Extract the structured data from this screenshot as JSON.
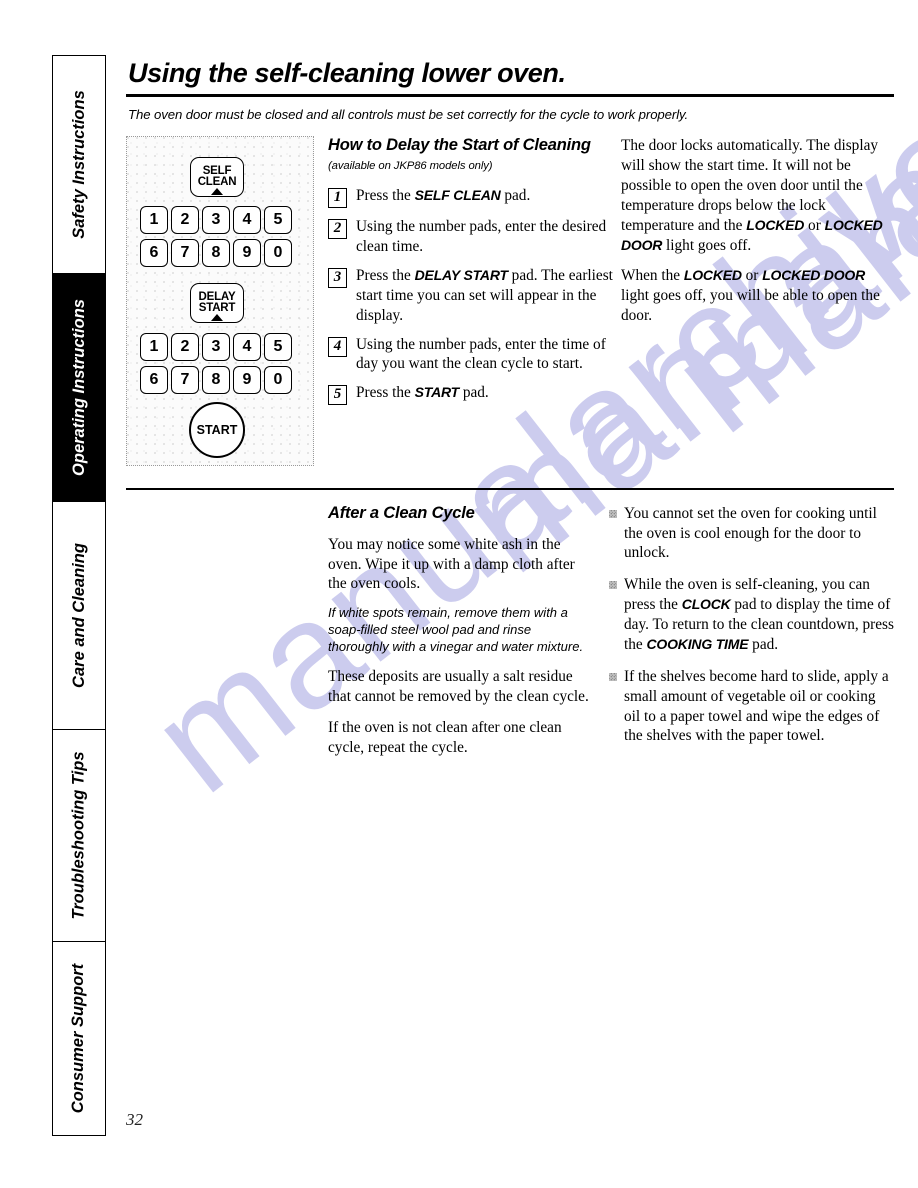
{
  "page": {
    "title": "Using the self-cleaning lower oven.",
    "subtitle": "The oven door must be closed and all controls must be set correctly for the cycle to work properly.",
    "number": "32",
    "watermark": "manualarchive.com"
  },
  "sidebar": {
    "tabs": [
      {
        "label": "Safety Instructions",
        "active": false
      },
      {
        "label": "Operating Instructions",
        "active": true
      },
      {
        "label": "Care and Cleaning",
        "active": false
      },
      {
        "label": "Troubleshooting Tips",
        "active": false
      },
      {
        "label": "Consumer Support",
        "active": false
      }
    ]
  },
  "keypad": {
    "self_clean_line1": "SELF",
    "self_clean_line2": "CLEAN",
    "delay_start_line1": "DELAY",
    "delay_start_line2": "START",
    "start_label": "START",
    "row_a": [
      "1",
      "2",
      "3",
      "4",
      "5"
    ],
    "row_b": [
      "6",
      "7",
      "8",
      "9",
      "0"
    ],
    "row_c": [
      "1",
      "2",
      "3",
      "4",
      "5"
    ],
    "row_d": [
      "6",
      "7",
      "8",
      "9",
      "0"
    ]
  },
  "delay_section": {
    "heading": "How to Delay the Start of Cleaning",
    "heading_note": "(available on JKP86 models only)",
    "steps": [
      {
        "num": "1",
        "text_html": "Press the <b>SELF CLEAN</b> pad."
      },
      {
        "num": "2",
        "text_html": "Using the number pads, enter the desired clean time."
      },
      {
        "num": "3",
        "text_html": "Press the <b>DELAY START</b> pad. The earliest start time you can set will appear in the display."
      },
      {
        "num": "4",
        "text_html": "Using the number pads, enter the time of day you want the clean cycle to start."
      },
      {
        "num": "5",
        "text_html": "Press the <b>START</b> pad."
      }
    ],
    "locked_paragraphs": [
      "The door locks automatically. The display will show the start time. It will not be possible to open the oven door until the temperature drops below the lock temperature and the <b>LOCKED</b> or <b>LOCKED DOOR</b> light goes off.",
      "When the <b>LOCKED</b> or <b>LOCKED DOOR</b> light goes off, you will be able to open the door."
    ]
  },
  "after_clean": {
    "heading": "After a Clean Cycle",
    "paragraphs": [
      {
        "style": "normal",
        "text": "You may notice some white ash in the oven. Wipe it up with a damp cloth after the oven cools."
      },
      {
        "style": "italic",
        "text": "If white spots remain, remove them with a soap-filled steel wool pad and rinse thoroughly with a vinegar and water mixture."
      },
      {
        "style": "normal",
        "text": "These deposits are usually a salt residue that cannot be removed by the clean cycle."
      },
      {
        "style": "normal",
        "text": "If the oven is not clean after one clean cycle, repeat the cycle."
      }
    ],
    "bullets": [
      "You cannot set the oven for cooking until the oven is cool enough for the door to unlock.",
      "While the oven is self-cleaning, you can press the <b>CLOCK</b> pad to display the time of day. To return to the clean countdown, press the <b>COOKING TIME</b> pad.",
      "If the shelves become hard to slide, apply a small amount of vegetable oil or cooking oil to a paper towel and wipe the edges of the shelves with the paper towel."
    ]
  }
}
